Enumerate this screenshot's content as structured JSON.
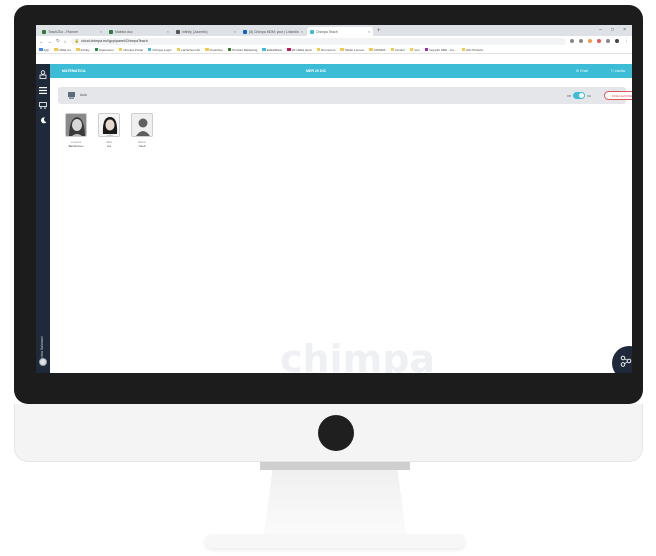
{
  "browser": {
    "tabs": [
      {
        "title": "Teach2Do - Planner",
        "color": "#2e7d32",
        "active": false
      },
      {
        "title": "Matrice.doc",
        "color": "#2b7a3d",
        "active": false
      },
      {
        "title": "Infinity (Jounetic)",
        "color": "#555555",
        "active": false
      },
      {
        "title": "(8) Chimpa MDM: your | LinkedIn",
        "color": "#0a66c2",
        "active": false
      },
      {
        "title": "Chimpa Teach",
        "color": "#3dbcd6",
        "active": true
      }
    ],
    "new_tab": "+",
    "window_controls": [
      "–",
      "□",
      "×"
    ],
    "url": "cloud.chimpa.eu/Igcp/panel/ChimpaTeach",
    "bookmarks": [
      "App",
      "Utilita.Co",
      "Infinity",
      "Classroom",
      "Chimpa Portal",
      "Chimpa Login",
      "LanSchool Air",
      "OneDrive",
      "Product Marketing",
      "Edtrafficker",
      "20 Utilità Iandi",
      "Drummers",
      "Tablet Lenovo",
      "CHIMPA",
      "Vendor",
      "Ven",
      "Copy42 SRD - Ce...",
      "Altri Preferiti"
    ]
  },
  "app": {
    "subject": "MATEMATICA",
    "date": "MER 20 DIC",
    "chat_label": "Chat",
    "exit_label": "Uscita",
    "class_name": "Aula",
    "toggle_left": "Off",
    "toggle_right": "On",
    "end_lesson_label": "FINE LEZIONE",
    "sidebar_user": "Monica Salomani",
    "watermark": "chimpa"
  },
  "students": [
    {
      "first": "Lorenza",
      "last": "Bartolomeo",
      "photo": "woman-photo"
    },
    {
      "first": "Alba",
      "last": "Lia",
      "photo": "girl-photo"
    },
    {
      "first": "Elena",
      "last": "Giudi",
      "photo": "placeholder"
    }
  ],
  "colors": {
    "accent": "#3dbcd6",
    "sidebar": "#1e2a3a",
    "danger": "#e0555e"
  }
}
